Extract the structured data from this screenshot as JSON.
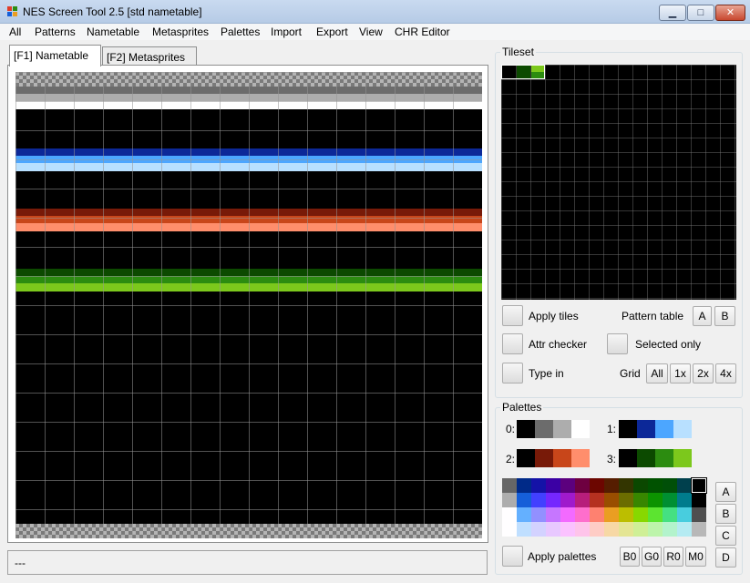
{
  "window": {
    "title": "NES Screen Tool 2.5  [std nametable]",
    "min_glyph": "▁",
    "max_glyph": "□",
    "close_glyph": "✕"
  },
  "menu": [
    "All",
    "Patterns",
    "Nametable",
    "Metasprites",
    "Palettes",
    "Import",
    "Export",
    "View",
    "CHR Editor"
  ],
  "tabs": [
    "[F1] Nametable",
    "[F2] Metasprites"
  ],
  "status": {
    "text": "---"
  },
  "tileset": {
    "title": "Tileset",
    "apply_tiles": "Apply tiles",
    "pattern_table_label": "Pattern table",
    "pattern_a": "A",
    "pattern_b": "B",
    "attr_checker": "Attr checker",
    "selected_only": "Selected only",
    "type_in": "Type in",
    "grid_label": "Grid",
    "grid_all": "All",
    "grid_1x": "1x",
    "grid_2x": "2x",
    "grid_4x": "4x"
  },
  "palettes": {
    "title": "Palettes",
    "labels": [
      "0:",
      "1:",
      "2:",
      "3:"
    ],
    "sets": [
      [
        "#000000",
        "#6c6c6c",
        "#adadad",
        "#ffffff"
      ],
      [
        "#000000",
        "#0c2898",
        "#4ca6ff",
        "#b8e0ff"
      ],
      [
        "#000000",
        "#781a08",
        "#c8461a",
        "#ff8e6c"
      ],
      [
        "#000000",
        "#0c4a00",
        "#2c8c10",
        "#7cc81c"
      ]
    ],
    "side_buttons": [
      "A",
      "B",
      "C",
      "D"
    ],
    "apply_palettes": "Apply palettes",
    "bottom_buttons": [
      "B0",
      "G0",
      "R0",
      "M0"
    ],
    "nes_rows": [
      [
        "#666666",
        "#002a88",
        "#1412a7",
        "#3b00a4",
        "#5c007e",
        "#6e0040",
        "#6c0600",
        "#561d00",
        "#333500",
        "#0b4800",
        "#005200",
        "#004f08",
        "#00404d",
        "#000000"
      ],
      [
        "#adadad",
        "#155fd9",
        "#4240ff",
        "#7527fe",
        "#a01acc",
        "#b71e7b",
        "#b53120",
        "#994e00",
        "#6b6d00",
        "#388700",
        "#0c9300",
        "#008f32",
        "#007c8d",
        "#000000"
      ],
      [
        "#fffeff",
        "#64b0ff",
        "#9290ff",
        "#c676ff",
        "#f36aff",
        "#fe6ecc",
        "#fe8170",
        "#ea9e22",
        "#bcbe00",
        "#88d800",
        "#5ce430",
        "#45e082",
        "#48cdde",
        "#4f4f4f"
      ],
      [
        "#fffeff",
        "#c0dfff",
        "#d3d2ff",
        "#e8c8ff",
        "#fbc2ff",
        "#fec4ea",
        "#feccc5",
        "#f7d8a5",
        "#e4e594",
        "#cfef96",
        "#bdf4ab",
        "#b3f3cc",
        "#b5ebf2",
        "#b8b8b8"
      ]
    ]
  },
  "colors": {
    "accent_selection": "#ffffff",
    "grid_line": "#5a5a5a"
  }
}
